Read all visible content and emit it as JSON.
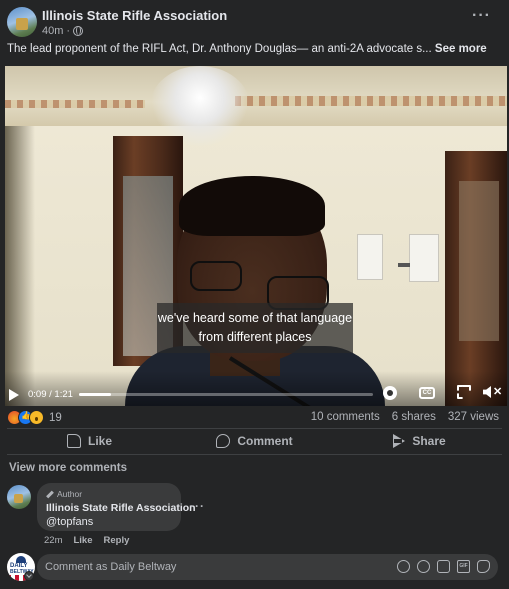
{
  "post": {
    "page_name": "Illinois State Rifle Association",
    "time": "40m",
    "separator": "·",
    "caption": "The lead proponent of the RIFL Act, Dr. Anthony Douglas— an anti-2A advocate s...",
    "see_more": "See more"
  },
  "video": {
    "subtitle": "we've heard some of that language from different places",
    "current_time": "0:09",
    "duration": "1:21",
    "time_display": "0:09 / 1:21",
    "progress_percent": 11,
    "cc_label": "CC"
  },
  "engagement": {
    "reaction_count": "19",
    "comments": "10 comments",
    "shares": "6 shares",
    "views": "327 views"
  },
  "actions": {
    "like": "Like",
    "comment": "Comment",
    "share": "Share"
  },
  "comments": {
    "view_more": "View more comments",
    "items": [
      {
        "badge": "Author",
        "name": "Illinois State Rifle Association",
        "text": "@topfans",
        "time": "22m",
        "like": "Like",
        "reply": "Reply"
      }
    ]
  },
  "composer": {
    "placeholder": "Comment as Daily Beltway",
    "avatar_line1": "DAILY",
    "avatar_line2": "BELTWAY",
    "gif_label": "GIF"
  },
  "colors": {
    "background": "#242526",
    "bubble": "#3a3b3c",
    "text_primary": "#e4e6eb",
    "text_secondary": "#b0b3b8",
    "like_blue": "#1877f2"
  }
}
